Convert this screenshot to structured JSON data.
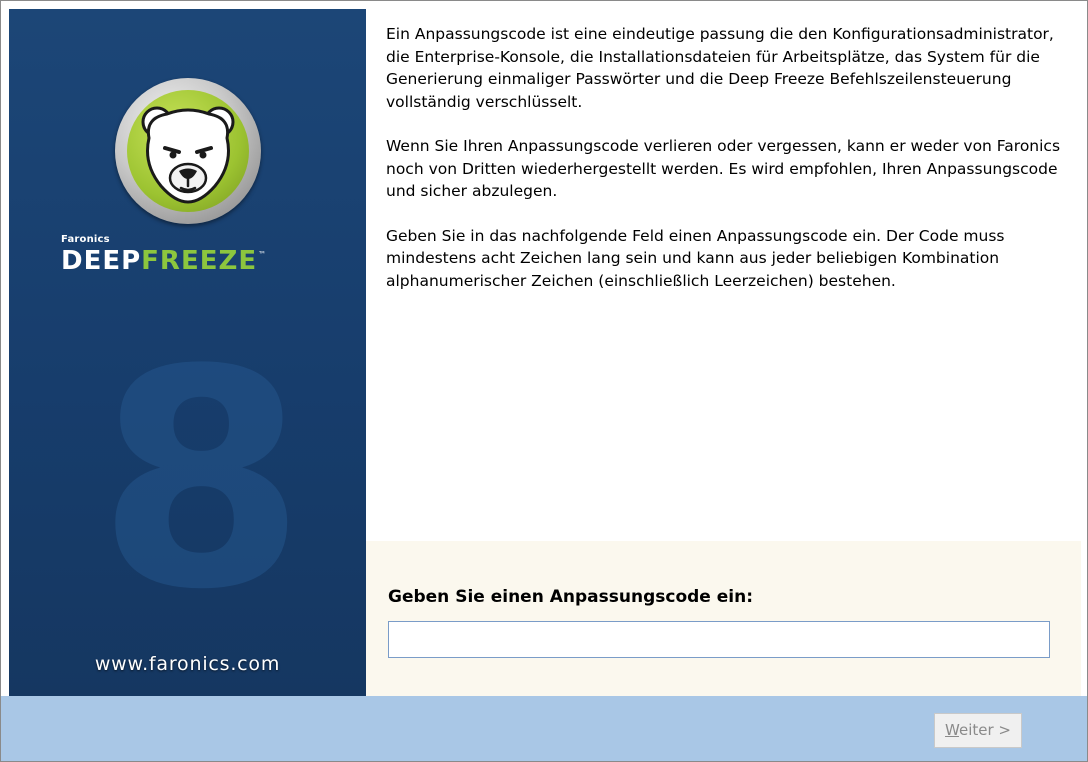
{
  "sidebar": {
    "brand_company": "Faronics",
    "brand_product_part1": "DEEP",
    "brand_product_part2": "FREEZE",
    "trademark": "™",
    "version_numeral": "8",
    "website": "www.faronics.com",
    "logo_icon": "polar-bear-logo-icon"
  },
  "content": {
    "paragraphs": [
      "Ein Anpassungscode ist eine eindeutige passung die den Konfigurationsadministrator, die Enterprise-Konsole, die Installationsdateien für Arbeitsplätze, das System für die Generierung einmaliger Passwörter und die Deep Freeze Befehlszeilensteuerung vollständig verschlüsselt.",
      "Wenn Sie Ihren Anpassungscode verlieren oder vergessen, kann er weder von Faronics noch von Dritten wiederhergestellt werden. Es wird empfohlen, Ihren Anpassungscode und sicher abzulegen.",
      "Geben Sie in das nachfolgende Feld einen Anpassungscode ein. Der Code muss mindestens acht Zeichen lang sein und kann aus jeder beliebigen Kombination alphanumerischer Zeichen (einschließlich Leerzeichen) bestehen."
    ],
    "code_label": "Geben Sie einen Anpassungscode ein:",
    "code_value": ""
  },
  "footer": {
    "next_mnemonic": "W",
    "next_rest": "eiter >"
  },
  "colors": {
    "sidebar_bg": "#1a4273",
    "brand_green": "#8cc63e",
    "input_zone_bg": "#fbf8ee",
    "footer_bg": "#a9c7e6"
  }
}
